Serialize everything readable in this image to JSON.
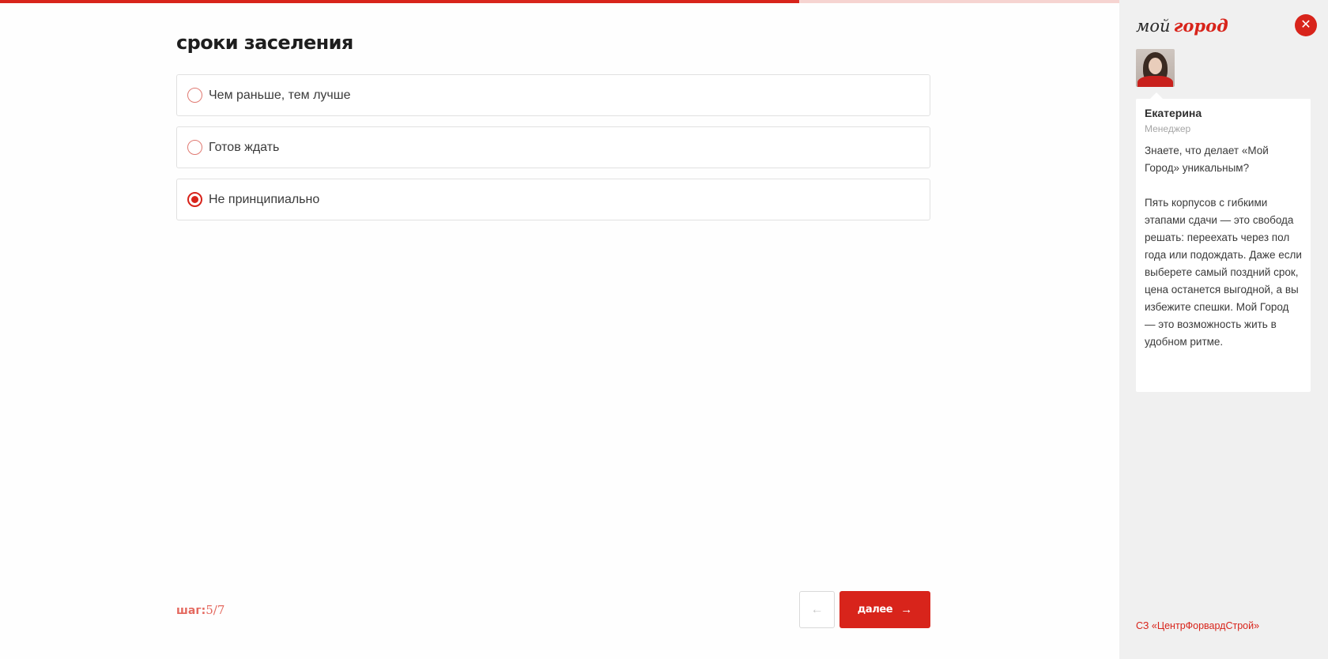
{
  "progress": {
    "value_percent": 71.4,
    "fill_color": "#d8241b",
    "track_color": "#f6d4d1"
  },
  "question": {
    "title": "сроки заселения"
  },
  "options": [
    {
      "label": "Чем раньше, тем лучше",
      "selected": false
    },
    {
      "label": "Готов ждать",
      "selected": false
    },
    {
      "label": "Не принципиально",
      "selected": true
    }
  ],
  "step": {
    "label": "шаг:",
    "current": "5",
    "total": "7"
  },
  "nav": {
    "back_icon": "arrow-left-icon",
    "next_label": "далее",
    "next_icon": "arrow-right-icon"
  },
  "sidebar": {
    "logo": {
      "part1": "мой",
      "part2": "город"
    },
    "close_icon": "close-icon",
    "manager": {
      "name": "Екатерина",
      "role": "Менеджер",
      "message": "Знаете, что делает «Мой Город» уникальным?\n\nПять корпусов с гибкими этапами сдачи — это свобода решать: переехать через пол года или подождать. Даже если выберете самый поздний срок, цена останется выгодной, а вы избежите спешки. Мой Город — это возможность жить в удобном ритме."
    },
    "company": "СЗ «ЦентрФорвардСтрой»"
  },
  "colors": {
    "accent": "#d8241b",
    "sidebar_bg": "#f0f0f0"
  }
}
